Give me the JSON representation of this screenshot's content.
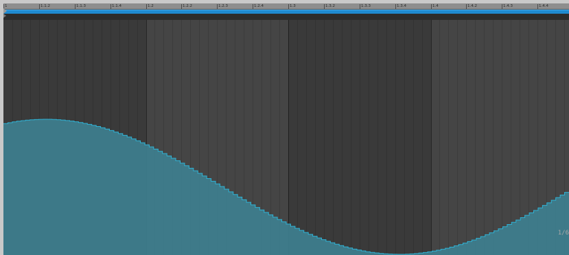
{
  "ruler": {
    "markers": [
      {
        "label": "1",
        "major": true
      },
      {
        "label": "1.1.2",
        "major": false
      },
      {
        "label": "1.1.3",
        "major": false
      },
      {
        "label": "1.1.4",
        "major": false
      },
      {
        "label": "1.2",
        "major": true
      },
      {
        "label": "1.2.2",
        "major": false
      },
      {
        "label": "1.2.3",
        "major": false
      },
      {
        "label": "1.2.4",
        "major": false
      },
      {
        "label": "1.3",
        "major": true
      },
      {
        "label": "1.3.2",
        "major": false
      },
      {
        "label": "1.3.3",
        "major": false
      },
      {
        "label": "1.3.4",
        "major": false
      },
      {
        "label": "1.4",
        "major": true
      },
      {
        "label": "1.4.2",
        "major": false
      },
      {
        "label": "1.4.3",
        "major": false
      },
      {
        "label": "1.4.4",
        "major": false
      }
    ]
  },
  "loop": {
    "color": "#1f8ad0"
  },
  "grid": {
    "beat_colors": [
      "#3a3a3a",
      "#454545",
      "#3a3a3a",
      "#454545"
    ],
    "subdivisions_per_beat": 16
  },
  "envelope": {
    "shape": "sine",
    "fill_color": "#3e7f8f",
    "stroke_color": "#2fb3d6",
    "steps_per_bar": 128
  },
  "page_indicator": "1/6"
}
